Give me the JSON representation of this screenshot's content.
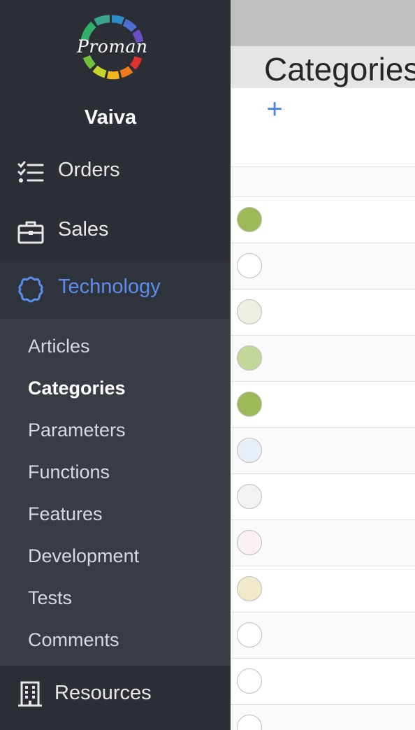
{
  "sidebar": {
    "logo_text": "Proman",
    "user_name": "Vaiva",
    "nav": {
      "orders": "Orders",
      "sales": "Sales",
      "technology": "Technology",
      "resources": "Resources"
    },
    "submenu": [
      "Articles",
      "Categories",
      "Parameters",
      "Functions",
      "Features",
      "Development",
      "Tests",
      "Comments"
    ],
    "active_submenu": "Categories",
    "accent_color": "#5b8def"
  },
  "main": {
    "title": "Categories",
    "add_label": "+",
    "category_colors": [
      "#9bbb59",
      "#ffffff",
      "#ebf1de",
      "#c4d79b",
      "#9bbb59",
      "#e7eef8",
      "#f2f2f2",
      "#f8f0f4",
      "#f1e9c9",
      "#ffffff",
      "#ffffff",
      "#ffffff"
    ]
  }
}
